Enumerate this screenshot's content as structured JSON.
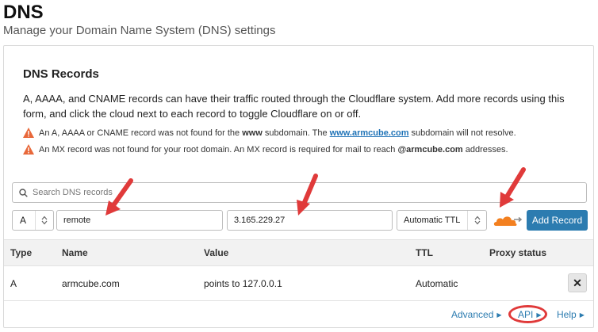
{
  "header": {
    "title": "DNS",
    "subtitle": "Manage your Domain Name System (DNS) settings"
  },
  "card": {
    "title": "DNS Records",
    "description": "A, AAAA, and CNAME records can have their traffic routed through the Cloudflare system. Add more records using this form, and click the cloud next to each record to toggle Cloudflare on or off.",
    "warnings": [
      {
        "pre": "An A, AAAA or CNAME record was not found for the ",
        "bold": "www",
        "mid": " subdomain. The ",
        "link": "www.armcube.com",
        "post": " subdomain will not resolve."
      },
      {
        "pre": "An MX record was not found for your root domain. An MX record is required for mail to reach ",
        "bold": "@armcube.com",
        "post": " addresses."
      }
    ]
  },
  "form": {
    "search_placeholder": "Search DNS records",
    "type_value": "A",
    "name_value": "remote",
    "content_value": "3.165.229.27",
    "ttl_value": "Automatic TTL",
    "add_button": "Add Record",
    "cloud_color": "#f38020"
  },
  "table": {
    "headers": [
      "Type",
      "Name",
      "Value",
      "TTL",
      "Proxy status"
    ],
    "rows": [
      {
        "type": "A",
        "name": "armcube.com",
        "value": "points to 127.0.0.1",
        "ttl": "Automatic",
        "proxy": ""
      }
    ],
    "delete_symbol": "✕"
  },
  "footer": {
    "advanced": "Advanced",
    "api": "API",
    "help": "Help"
  },
  "colors": {
    "accent": "#2c7cb0",
    "warning": "#e8683a",
    "annotation": "#e03a3a"
  }
}
